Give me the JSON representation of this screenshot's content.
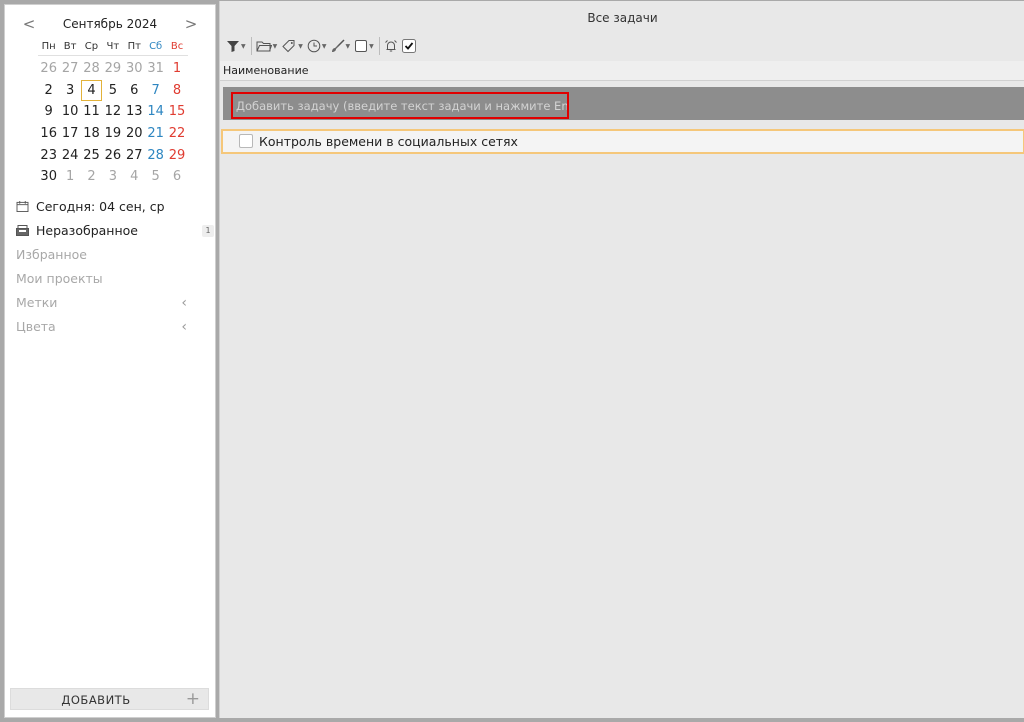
{
  "calendar": {
    "title": "Сентябрь 2024",
    "prev": "<",
    "next": ">",
    "weekdays": [
      "Пн",
      "Вт",
      "Ср",
      "Чт",
      "Пт",
      "Сб",
      "Вс"
    ],
    "weeks": [
      [
        "26",
        "27",
        "28",
        "29",
        "30",
        "31",
        "1"
      ],
      [
        "2",
        "3",
        "4",
        "5",
        "6",
        "7",
        "8"
      ],
      [
        "9",
        "10",
        "11",
        "12",
        "13",
        "14",
        "15"
      ],
      [
        "16",
        "17",
        "18",
        "19",
        "20",
        "21",
        "22"
      ],
      [
        "23",
        "24",
        "25",
        "26",
        "27",
        "28",
        "29"
      ],
      [
        "30",
        "1",
        "2",
        "3",
        "4",
        "5",
        "6"
      ]
    ]
  },
  "sidebar": {
    "today": "Сегодня: 04 сен, ср",
    "inbox": "Неразобранное",
    "inbox_count": "1",
    "favorites": "Избранное",
    "projects": "Мои проекты",
    "tags": "Метки",
    "colors": "Цвета",
    "add_button": "ДОБАВИТЬ",
    "add_plus": "+"
  },
  "main": {
    "title": "Все задачи",
    "column_name": "Наименование",
    "add_task_placeholder": "Добавить задачу (введите текст задачи и нажмите Enter)...",
    "tasks": [
      {
        "title": "Контроль времени в социальных сетях",
        "done": false
      }
    ]
  },
  "colors": {
    "weekend_sat": "#2e86c1",
    "weekend_sun": "#e03c31",
    "today_border": "#e2b23a",
    "focus_border": "#e00000",
    "task_highlight": "#f5c77a"
  }
}
